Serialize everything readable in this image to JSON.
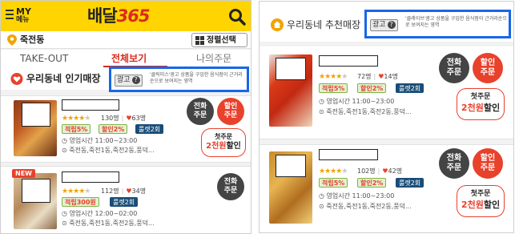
{
  "left": {
    "header": {
      "my_label": "MY",
      "menu_label": "메뉴",
      "logo_korean": "배달",
      "logo_number": "365"
    },
    "location": {
      "text": "죽전동",
      "sort_label": "정렬선택"
    },
    "tabs": [
      "TAKE-OUT",
      "전체보기",
      "나의주문"
    ],
    "section_title": "우리동네 인기매장",
    "ad": {
      "badge": "광고",
      "description": "'클릭미스'광고 상품을 구입한 음식점이 근거리순으로 보여지는 영역"
    },
    "cards": [
      {
        "rating": "130명",
        "likes": "63명",
        "tags": [
          "적립5%",
          "할인2%",
          "룰렛2회"
        ],
        "hours": "영업시간 11:00~23:00",
        "area": "죽전동,죽전1동,죽전2동,풍덕...",
        "call_button": [
          "전화",
          "주문"
        ],
        "discount_button": [
          "할인",
          "주문"
        ],
        "coupon": {
          "line1": "첫주문",
          "amount": "2천원",
          "suffix": "할인"
        }
      },
      {
        "new_badge": "NEW",
        "rating": "112명",
        "likes": "34명",
        "tags": [
          "적립300원",
          "룰렛2회"
        ],
        "hours": "영업시간 12:00~02:00",
        "area": "죽전동,죽전1동,죽전2동,풍덕...",
        "call_button": [
          "전화",
          "주문"
        ]
      }
    ]
  },
  "right": {
    "section_title": "우리동네 추천매장",
    "ad": {
      "badge": "광고",
      "description": "'클레이브'광고 상품을 구입한 음식점이 근거리순으로 보여지는 영역"
    },
    "cards": [
      {
        "rating": "72명",
        "likes": "14명",
        "tags": [
          "적립5%",
          "할인2%",
          "룰렛2회"
        ],
        "hours": "영업시간 11:00~23:00",
        "area": "죽전동,죽전1동,죽전2동,풍덕...",
        "call_button": [
          "전화",
          "주문"
        ],
        "discount_button": [
          "할인",
          "주문"
        ],
        "coupon": {
          "line1": "첫주문",
          "amount": "2천원",
          "suffix": "할인"
        }
      },
      {
        "rating": "102명",
        "likes": "42명",
        "tags": [
          "적립5%",
          "할인2%",
          "룰렛2회"
        ],
        "hours": "영업시간 11:00~23:00",
        "area": "죽전동,죽전1동,죽전2동,풍덕...",
        "call_button": [
          "전화",
          "주문"
        ],
        "discount_button": [
          "할인",
          "주문"
        ],
        "coupon": {
          "line1": "첫주문",
          "amount": "2천원",
          "suffix": "할인"
        }
      }
    ]
  },
  "colors": {
    "brand_yellow": "#ffd400",
    "accent_red": "#e8412c",
    "highlight_blue": "#1767e8",
    "tag_navy": "#1a4d78"
  },
  "icons": [
    "menu-icon",
    "search-icon",
    "location-pin-icon",
    "grid-icon",
    "heart-icon",
    "house-icon",
    "question-icon",
    "clock-icon",
    "map-pin-icon"
  ]
}
